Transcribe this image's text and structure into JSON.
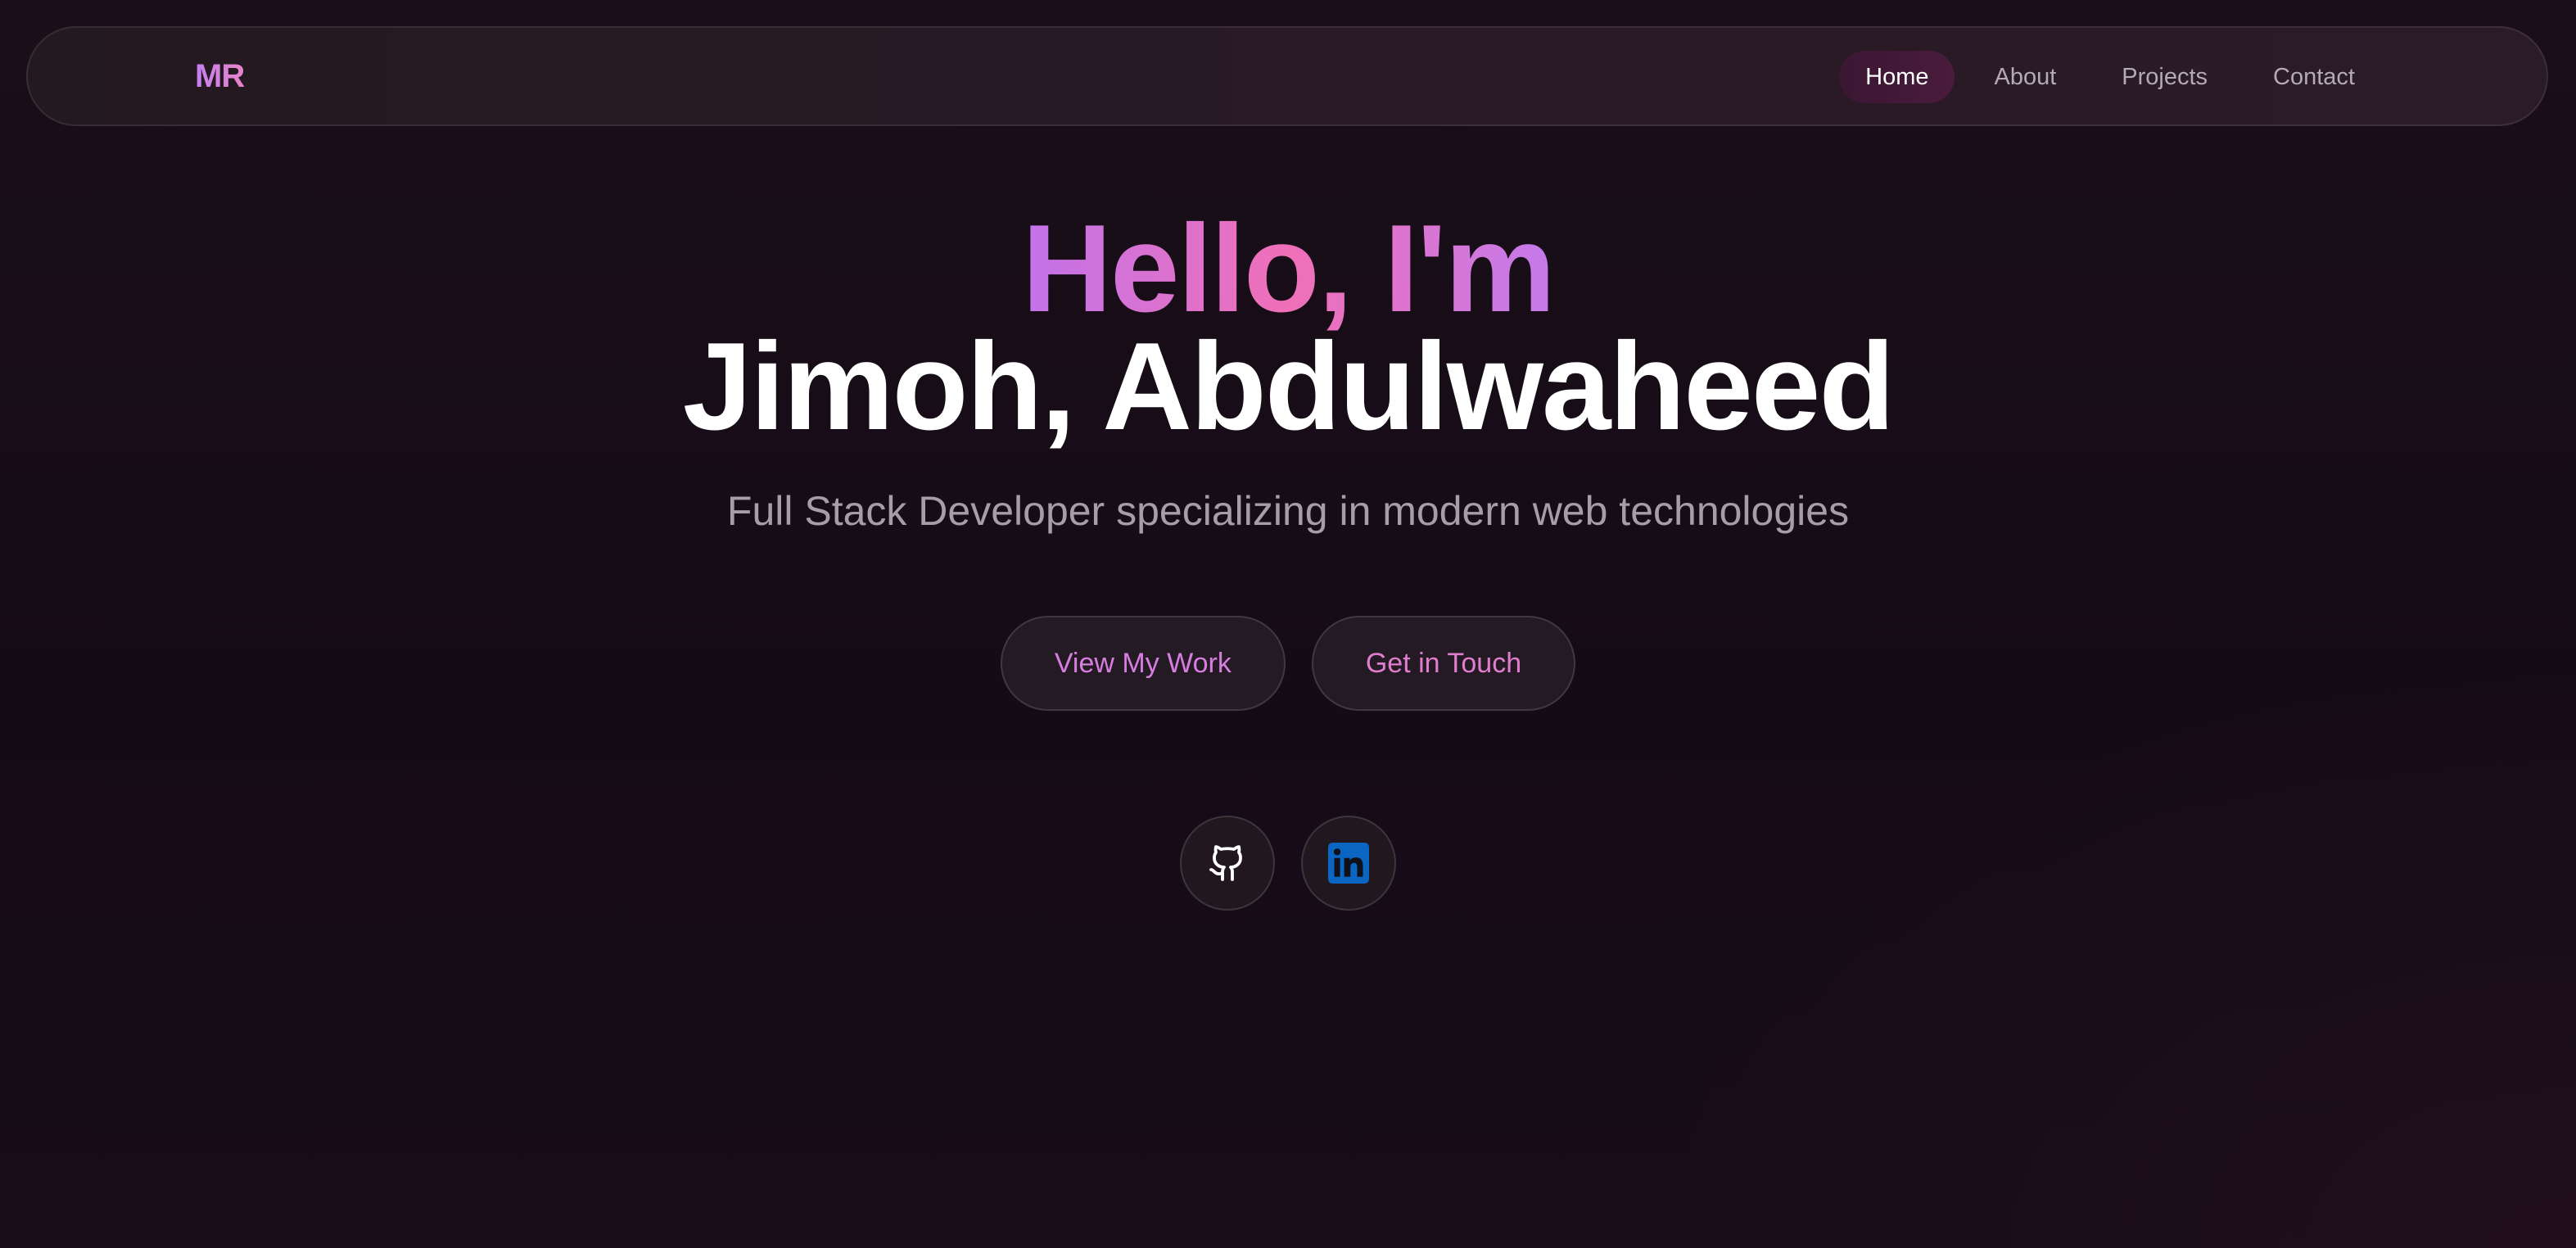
{
  "navbar": {
    "logo": "MR",
    "links": [
      {
        "label": "Home",
        "active": true
      },
      {
        "label": "About",
        "active": false
      },
      {
        "label": "Projects",
        "active": false
      },
      {
        "label": "Contact",
        "active": false
      }
    ]
  },
  "hero": {
    "greeting": "Hello, I'm",
    "name": "Jimoh, Abdulwaheed",
    "tagline": "Full Stack Developer specializing in modern web technologies"
  },
  "cta": {
    "primary_label": "View My Work",
    "secondary_label": "Get in Touch"
  },
  "social": [
    {
      "icon": "github-icon"
    },
    {
      "icon": "linkedin-icon"
    }
  ],
  "colors": {
    "background": "#160c16",
    "accent_purple": "#c273ea",
    "accent_pink": "#f070b8",
    "linkedin_blue": "#0a66c2",
    "muted_text": "#a59ea6"
  }
}
